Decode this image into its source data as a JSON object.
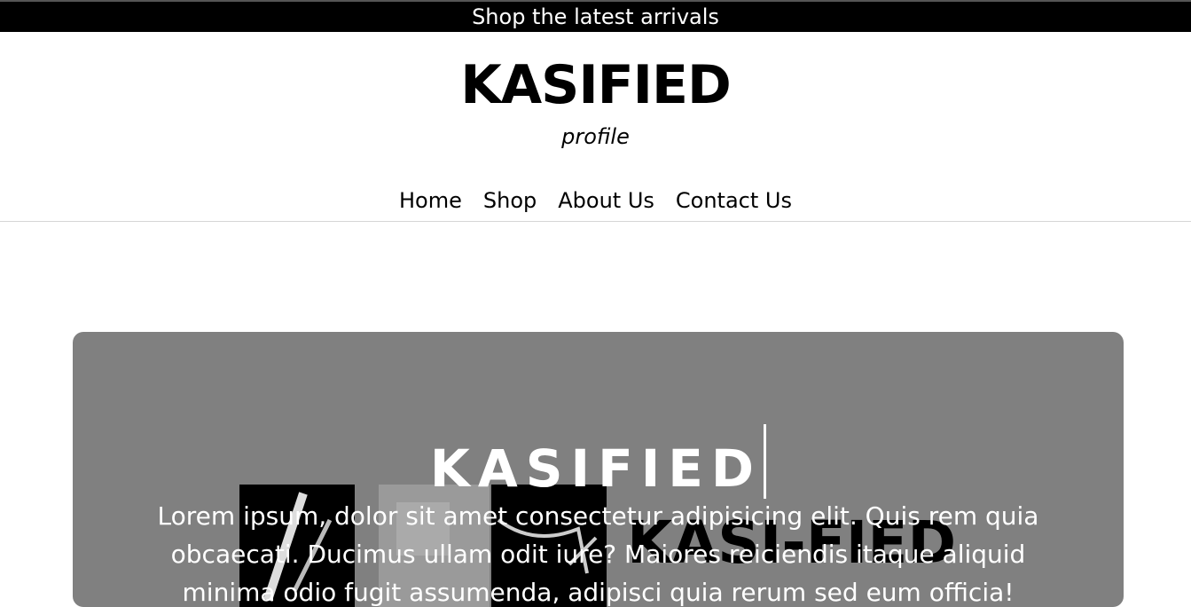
{
  "announcement": {
    "text": "Shop the latest arrivals"
  },
  "header": {
    "title": "KASIFIED",
    "subtitle": "profile"
  },
  "nav": {
    "items": [
      {
        "label": "Home"
      },
      {
        "label": "Shop"
      },
      {
        "label": "About Us"
      },
      {
        "label": "Contact Us"
      }
    ]
  },
  "hero": {
    "title": "KASIFIED",
    "logo_text": "KASI-FIED",
    "text": "Lorem ipsum, dolor sit amet consectetur adipisicing elit. Quis rem quia obcaecati. Ducimus ullam odit iure? Maiores reiciendis itaque aliquid minima odio fugit assumenda, adipisci quia rerum sed eum officia!",
    "background_color": "#808080"
  }
}
